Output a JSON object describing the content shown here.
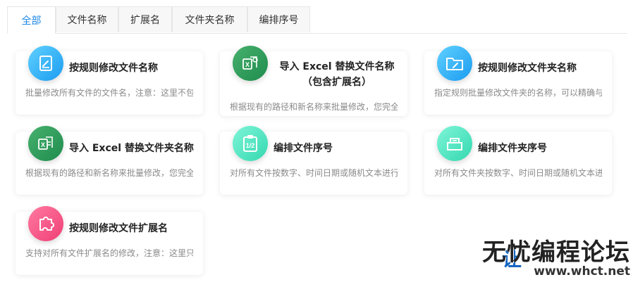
{
  "tabs": [
    {
      "label": "全部",
      "active": true
    },
    {
      "label": "文件名称",
      "active": false
    },
    {
      "label": "扩展名",
      "active": false
    },
    {
      "label": "文件夹名称",
      "active": false
    },
    {
      "label": "编排序号",
      "active": false
    }
  ],
  "cards": [
    {
      "title": "按规则修改文件名称",
      "desc": "批量修改所有文件的文件名，注意：这里不包",
      "icon": "edit-document-icon",
      "color": "blue"
    },
    {
      "title_line1": "导入 Excel 替换文件名称",
      "title_line2": "（包含扩展名）",
      "desc": "根据现有的路径和新名称来批量修改，您完全",
      "icon": "excel-replace-icon",
      "color": "green"
    },
    {
      "title": "按规则修改文件夹名称",
      "desc": "指定规则批量修改文件夹的名称，可以精确与",
      "icon": "folder-edit-icon",
      "color": "blue"
    },
    {
      "title": "导入 Excel 替换文件夹名称",
      "desc": "根据现有的路径和新名称来批量修改，您完全",
      "icon": "excel-replace-icon",
      "color": "green"
    },
    {
      "title": "编排文件序号",
      "desc": "对所有文件按数字、时间日期或随机文本进行",
      "icon": "clipboard-number-icon",
      "color": "mint"
    },
    {
      "title": "编排文件夹序号",
      "desc": "对所有文件夹按数字、时间日期或随机文本进",
      "icon": "folder-number-icon",
      "color": "mint"
    },
    {
      "title": "按规则修改文件扩展名",
      "desc": "支持对所有文件扩展名的修改，注意：这里只",
      "icon": "puzzle-icon",
      "color": "pink"
    }
  ],
  "watermark": {
    "line1": "无忧编程论坛",
    "line2": "www.whct.net"
  },
  "colors": {
    "accent": "#1e88e5",
    "blue": "#1c9cf0",
    "green": "#1f8c4e",
    "mint": "#34d8b0",
    "pink": "#ef3f76"
  }
}
